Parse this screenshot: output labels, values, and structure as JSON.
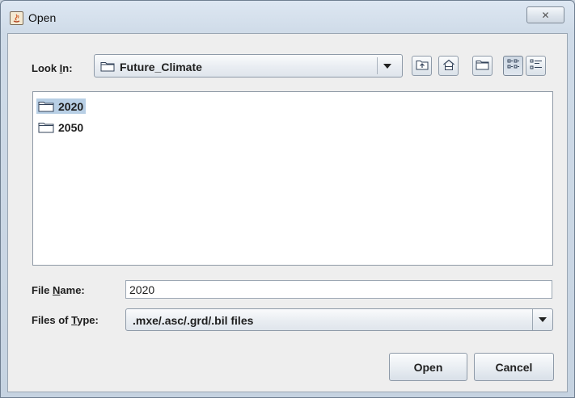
{
  "window": {
    "title": "Open",
    "close_glyph": "✕"
  },
  "look_in": {
    "label_prefix": "Look ",
    "label_mnemonic": "I",
    "label_suffix": "n:",
    "value": "Future_Climate"
  },
  "toolbar": {
    "buttons": [
      {
        "icon": "up-one-level-icon"
      },
      {
        "icon": "home-icon"
      },
      {
        "icon": "new-folder-icon"
      },
      {
        "icon": "list-view-icon",
        "pressed": true
      },
      {
        "icon": "details-view-icon",
        "pressed": false
      }
    ]
  },
  "file_list": {
    "items": [
      {
        "name": "2020",
        "type": "folder",
        "selected": true
      },
      {
        "name": "2050",
        "type": "folder",
        "selected": false
      }
    ]
  },
  "file_name": {
    "label_prefix": "File ",
    "label_mnemonic": "N",
    "label_suffix": "ame:",
    "value": "2020"
  },
  "file_type": {
    "label_prefix": "Files of ",
    "label_mnemonic": "T",
    "label_suffix": "ype:",
    "value": ".mxe/.asc/.grd/.bil files"
  },
  "actions": {
    "open_label": "Open",
    "cancel_label": "Cancel"
  },
  "colors": {
    "selection": "#b8cfe5",
    "title_bar": "#dde7f2"
  }
}
